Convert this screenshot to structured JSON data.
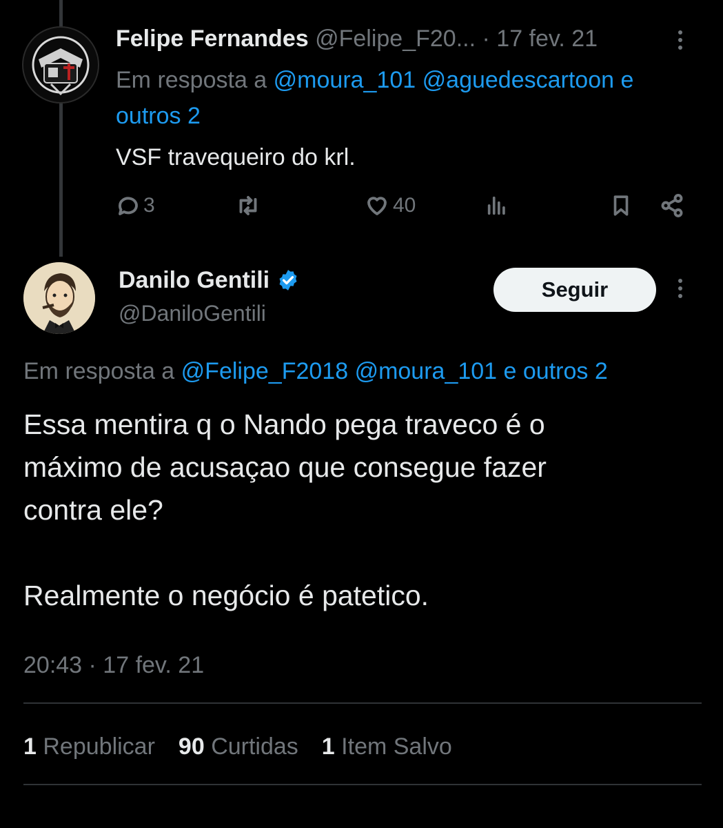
{
  "tweet1": {
    "name": "Felipe Fernandes",
    "handle": "@Felipe_F20...",
    "separator": "·",
    "date": "17 fev. 21",
    "reply_prefix": "Em resposta a",
    "reply_mention1": "@moura_101",
    "reply_mention2": "@aguedescartoon",
    "reply_others": "e outros 2",
    "text": "VSF travequeiro do krl.",
    "replies": "3",
    "likes": "40"
  },
  "tweet2": {
    "name": "Danilo Gentili",
    "handle": "@DaniloGentili",
    "follow_label": "Seguir",
    "reply_prefix": "Em resposta a",
    "reply_mention1": "@Felipe_F2018",
    "reply_mention2": "@moura_101",
    "reply_others": "e outros 2",
    "text_line1": "Essa mentira q o Nando pega traveco é o",
    "text_line2": "máximo de acusaçao que consegue fazer",
    "text_line3": "contra ele?",
    "text_line4": "Realmente o negócio é patetico.",
    "timestamp": "20:43 · 17 fev. 21",
    "stats": {
      "reposts_count": "1",
      "reposts_label": "Republicar",
      "likes_count": "90",
      "likes_label": "Curtidas",
      "saves_count": "1",
      "saves_label": "Item Salvo"
    }
  },
  "colors": {
    "background": "#000000",
    "text": "#e7e9ea",
    "muted": "#71767b",
    "link": "#1d9bf0",
    "verified": "#1d9bf0"
  },
  "icons": [
    "reply-icon",
    "repost-icon",
    "like-icon",
    "views-icon",
    "bookmark-icon",
    "share-icon",
    "verified-badge-icon",
    "more-icon"
  ]
}
